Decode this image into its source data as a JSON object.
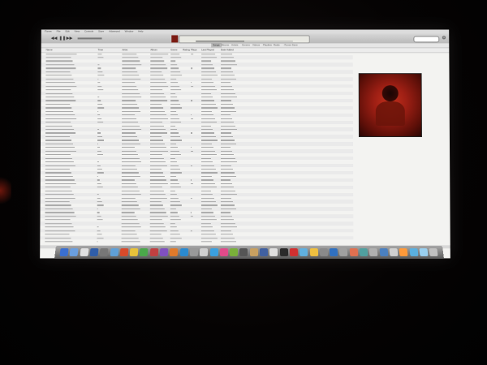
{
  "menubar": {
    "items": [
      "iTunes",
      "File",
      "Edit",
      "View",
      "Controls",
      "Store",
      "Advanced",
      "Window",
      "Help"
    ]
  },
  "toolbar": {
    "prev_label": "◀◀",
    "play_label": "❚❚",
    "next_label": "▶▶",
    "lcd_line1": "",
    "lcd_line2": "",
    "progress": 0.5,
    "search_placeholder": ""
  },
  "tabs": [
    "Songs",
    "Albums",
    "Artists",
    "Genres",
    "Videos",
    "Playlists",
    "Radio",
    "iTunes Store"
  ],
  "active_tab": 0,
  "table": {
    "columns": [
      "Name",
      "Time",
      "Artist",
      "Album",
      "Genre",
      "Rating",
      "Plays",
      "Last Played",
      "Date Added"
    ],
    "rows": 53
  },
  "statusbar": {
    "text": ""
  }
}
